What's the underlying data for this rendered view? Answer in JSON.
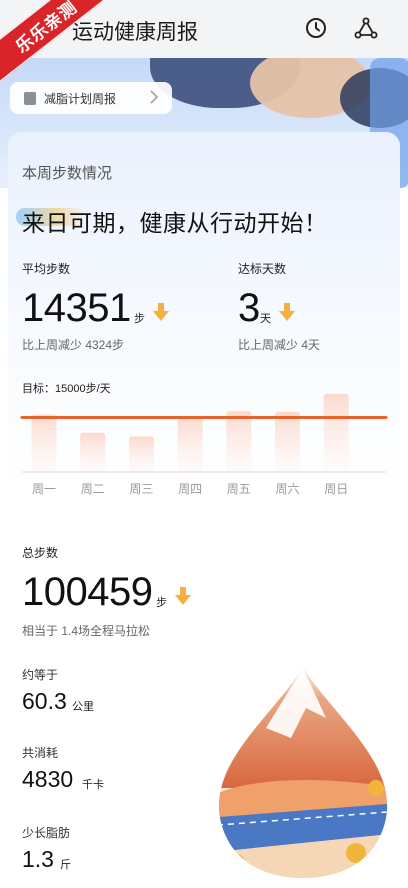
{
  "header": {
    "title": "运动健康周报",
    "watermark": "乐乐亲测",
    "history_icon": "clock-icon",
    "share_icon": "share-icon"
  },
  "banner": {
    "plan_chip_label": "减脂计划周报"
  },
  "weekly": {
    "section_label": "本周步数情况",
    "slogan": "来日可期，健康从行动开始！",
    "avg_steps": {
      "label": "平均步数",
      "value": "14351",
      "unit": "步",
      "compare": "比上周减少 4324步"
    },
    "goal_days": {
      "label": "达标天数",
      "value": "3",
      "unit": "天",
      "compare": "比上周减少 4天"
    },
    "goal_text": "目标：15000步/天"
  },
  "chart_data": {
    "type": "bar",
    "categories": [
      "周一",
      "周二",
      "周三",
      "周四",
      "周五",
      "周六",
      "周日"
    ],
    "values": [
      15800,
      10800,
      9800,
      15300,
      16700,
      16500,
      21500
    ],
    "goal": 15000,
    "ylim": [
      0,
      22000
    ],
    "title": "",
    "xlabel": "",
    "ylabel": ""
  },
  "totals": {
    "total_label": "总步数",
    "total_value": "100459",
    "total_unit": "步",
    "marathon_text": "相当于 1.4场全程马拉松",
    "distance_label": "约等于",
    "distance_value": "60.3",
    "distance_unit": "公里",
    "calories_label": "共消耗",
    "calories_value": "4830",
    "calories_unit": "千卡",
    "fat_label": "少长脂肪",
    "fat_value": "1.3",
    "fat_unit": "斤"
  },
  "colors": {
    "accent_orange": "#e8622c",
    "bar_fill_top": "#fbd9cd",
    "arrow_orange": "#f5b041",
    "watermark_red": "#d9252a"
  }
}
